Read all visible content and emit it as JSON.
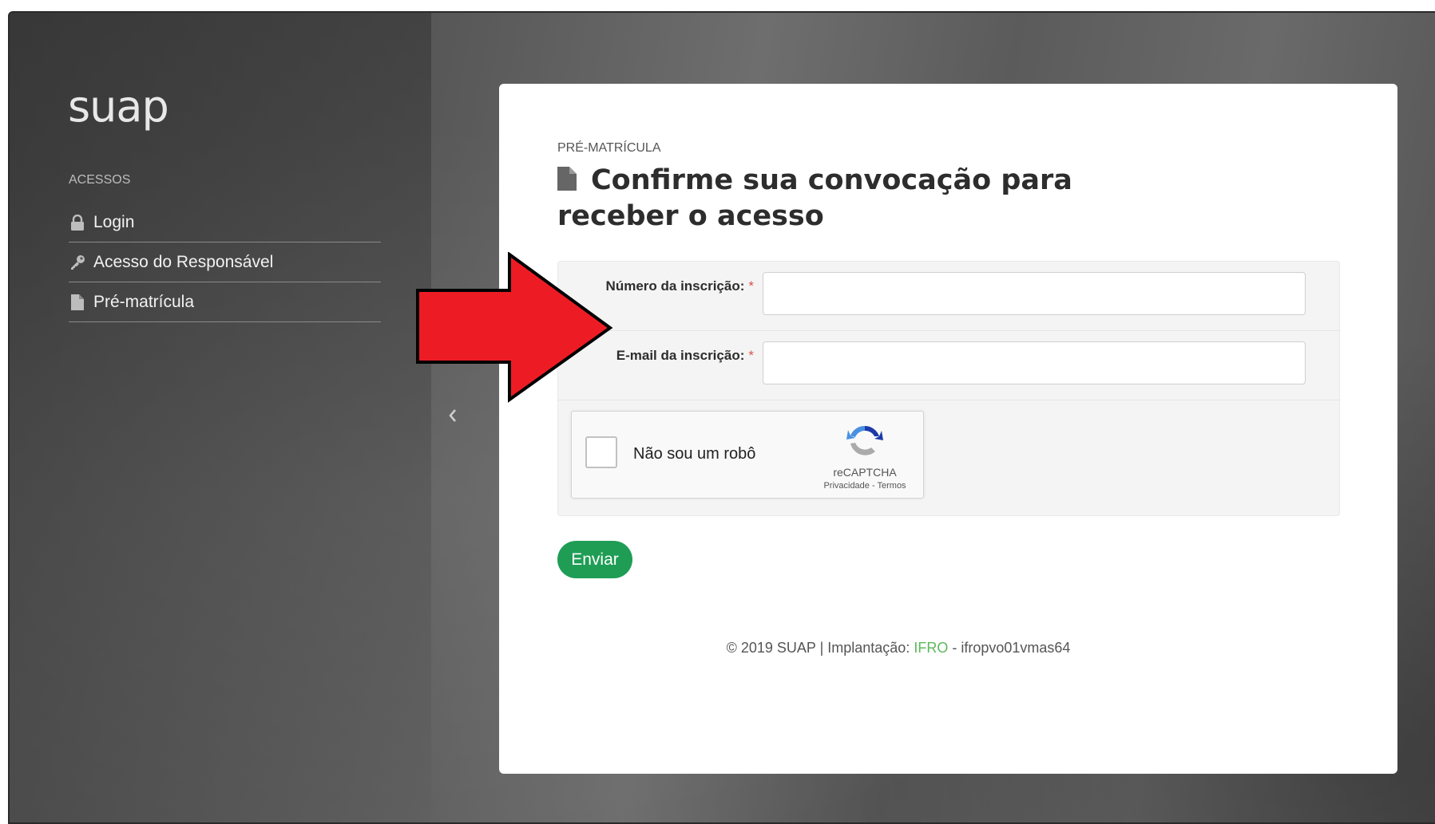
{
  "app": {
    "logo": "suap"
  },
  "sidebar": {
    "heading": "ACESSOS",
    "items": [
      {
        "label": "Login",
        "icon": "lock-icon"
      },
      {
        "label": "Acesso do Responsável",
        "icon": "key-icon"
      },
      {
        "label": "Pré-matrícula",
        "icon": "document-icon"
      }
    ]
  },
  "main": {
    "breadcrumb": "PRÉ-MATRÍCULA",
    "title": "Confirme sua convocação para receber o acesso",
    "title_icon": "document-icon",
    "form": {
      "fields": [
        {
          "label": "Número da inscrição:",
          "required_mark": "*",
          "value": ""
        },
        {
          "label": "E-mail da inscrição:",
          "required_mark": "*",
          "value": ""
        }
      ],
      "captcha": {
        "label": "Não sou um robô",
        "brand": "reCAPTCHA",
        "privacy": "Privacidade",
        "separator": " - ",
        "terms": "Termos"
      },
      "submit_label": "Enviar"
    },
    "footer": {
      "prefix": "© 2019 SUAP | Implantação: ",
      "link": "IFRO",
      "suffix": " - ifropvo01vmas64"
    }
  },
  "colors": {
    "submit": "#1f9d55",
    "required": "#d9534f",
    "footer_link": "#5cb85c",
    "annotation_arrow": "#ed1c24"
  }
}
